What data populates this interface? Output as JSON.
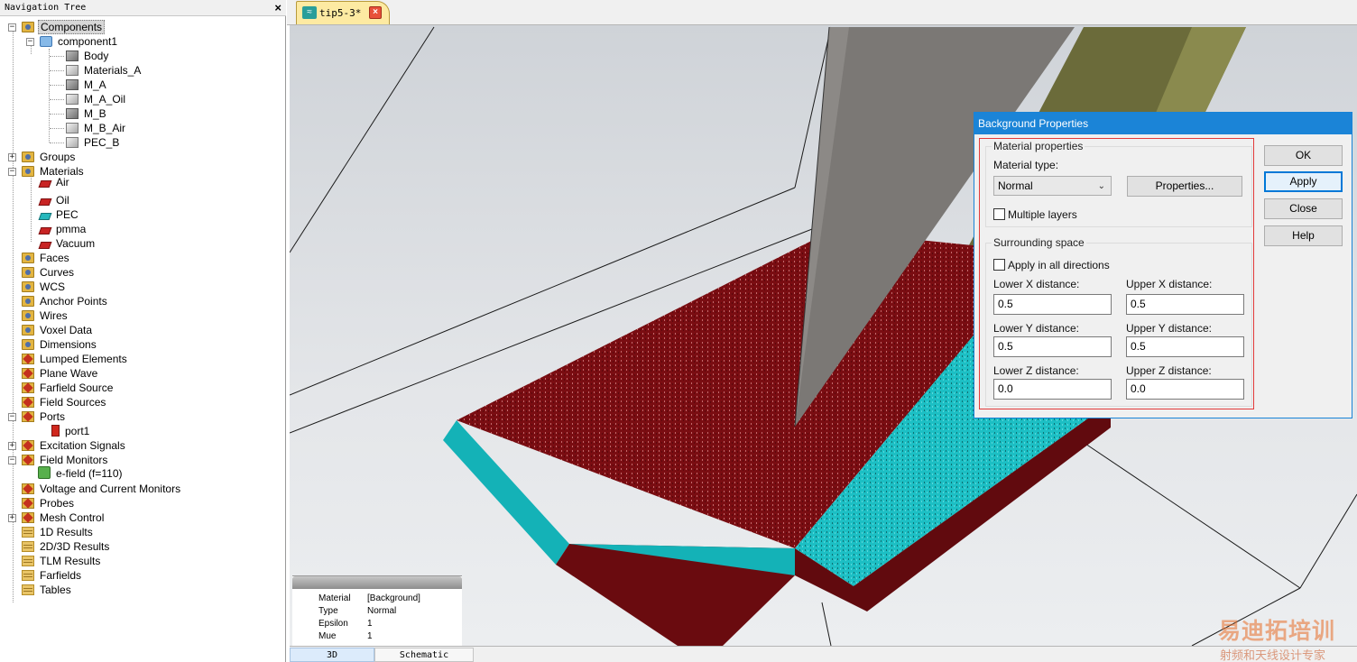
{
  "nav": {
    "title": "Navigation Tree",
    "close": "×"
  },
  "tree": {
    "components": "Components",
    "component1": "component1",
    "shapes": [
      "Body",
      "Materials_A",
      "M_A",
      "M_A_Oil",
      "M_B",
      "M_B_Air",
      "PEC_B"
    ],
    "groups": "Groups",
    "materials": "Materials",
    "material_items": [
      "Air",
      "Oil",
      "PEC",
      "pmma",
      "Vacuum"
    ],
    "faces": "Faces",
    "curves": "Curves",
    "wcs": "WCS",
    "anchor_points": "Anchor Points",
    "wires": "Wires",
    "voxel_data": "Voxel Data",
    "dimensions": "Dimensions",
    "lumped_elements": "Lumped Elements",
    "plane_wave": "Plane Wave",
    "farfield_source": "Farfield Source",
    "field_sources": "Field Sources",
    "ports": "Ports",
    "port1": "port1",
    "excitation_signals": "Excitation Signals",
    "field_monitors": "Field Monitors",
    "efield": "e-field (f=110)",
    "voltage_current": "Voltage and Current Monitors",
    "probes": "Probes",
    "mesh_control": "Mesh Control",
    "results_1d": "1D Results",
    "results_2d3d": "2D/3D Results",
    "tlm_results": "TLM Results",
    "farfields": "Farfields",
    "tables": "Tables"
  },
  "document_tab": {
    "name": "tip5-3*"
  },
  "info_box": {
    "rows": [
      {
        "key": "Material",
        "value": "[Background]"
      },
      {
        "key": "Type",
        "value": "Normal"
      },
      {
        "key": "Epsilon",
        "value": "1"
      },
      {
        "key": "Mue",
        "value": "1"
      }
    ]
  },
  "bottom_tabs": {
    "tab_3d": "3D",
    "tab_schematic": "Schematic"
  },
  "dialog": {
    "title": "Background Properties",
    "material_group": "Material properties",
    "material_type_label": "Material type:",
    "material_type_value": "Normal",
    "properties_button": "Properties...",
    "multiple_layers": "Multiple layers",
    "surrounding_group": "Surrounding space",
    "apply_all": "Apply in all directions",
    "lower_x_label": "Lower X distance:",
    "upper_x_label": "Upper X distance:",
    "lower_y_label": "Lower Y distance:",
    "upper_y_label": "Upper Y distance:",
    "lower_z_label": "Lower Z distance:",
    "upper_z_label": "Upper Z distance:",
    "lower_x": "0.5",
    "upper_x": "0.5",
    "lower_y": "0.5",
    "upper_y": "0.5",
    "lower_z": "0.0",
    "upper_z": "0.0",
    "ok": "OK",
    "apply": "Apply",
    "close": "Close",
    "help": "Help"
  },
  "watermark": {
    "big": "易迪拓培训",
    "small": "射频和天线设计专家"
  },
  "colors": {
    "accent": "#1b84d7",
    "substrate": "#7a0d12",
    "pec": "#1cbfc4",
    "olive": "#6b6b3a",
    "probe_tip": "#7b7875"
  }
}
